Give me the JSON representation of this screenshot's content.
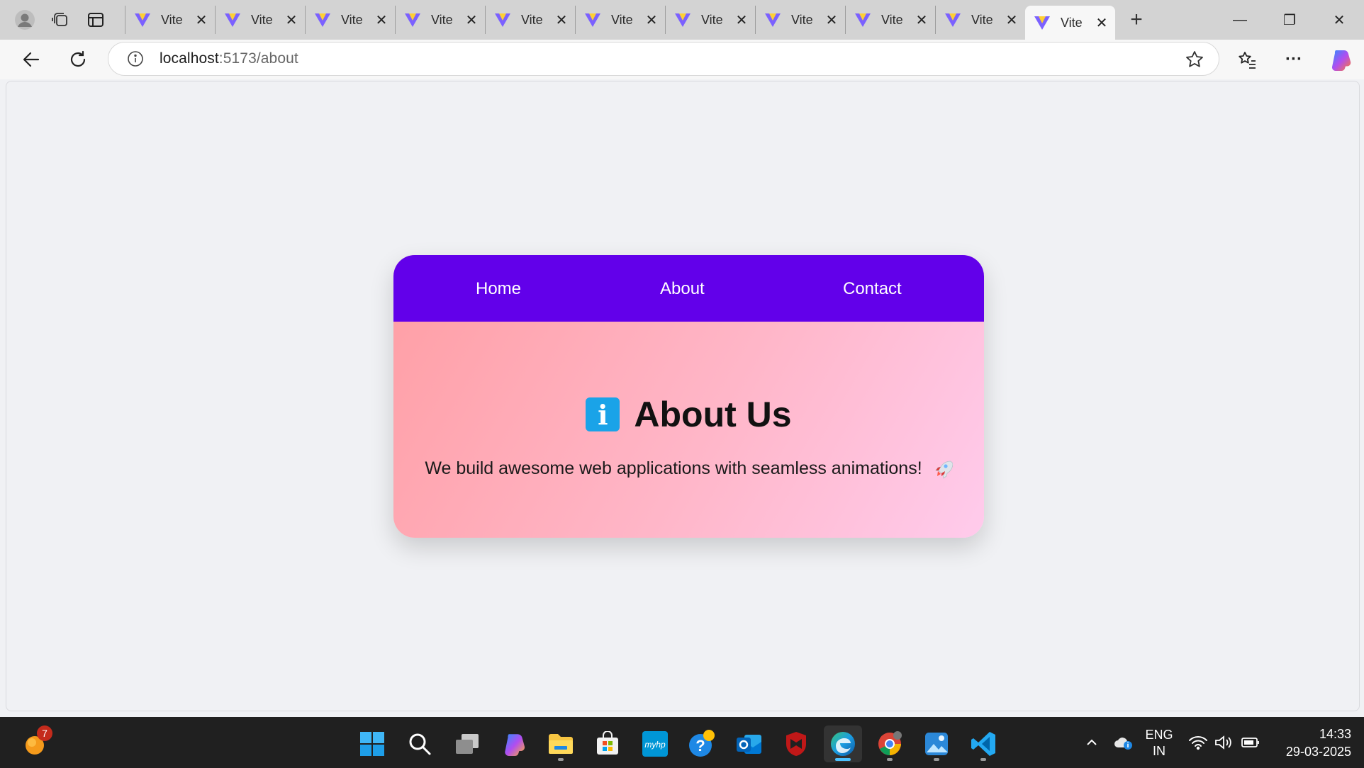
{
  "browser": {
    "tabs": [
      {
        "title": "Vite",
        "active": false
      },
      {
        "title": "Vite",
        "active": false
      },
      {
        "title": "Vite",
        "active": false
      },
      {
        "title": "Vite",
        "active": false
      },
      {
        "title": "Vite",
        "active": false
      },
      {
        "title": "Vite",
        "active": false
      },
      {
        "title": "Vite",
        "active": false
      },
      {
        "title": "Vite",
        "active": false
      },
      {
        "title": "Vite",
        "active": false
      },
      {
        "title": "Vite",
        "active": false
      },
      {
        "title": "Vite",
        "active": true
      }
    ],
    "tab_close_glyph": "✕",
    "new_tab_glyph": "+",
    "url_host": "localhost",
    "url_path": ":5173/about",
    "window_controls": {
      "minimize": "—",
      "restore": "❐",
      "close": "✕"
    },
    "more_glyph": "···"
  },
  "page": {
    "nav": {
      "home": "Home",
      "about": "About",
      "contact": "Contact"
    },
    "title": "About Us",
    "info_glyph": "i",
    "description": "We build awesome web applications with seamless animations!",
    "colors": {
      "nav_bg": "#6200ea",
      "card_gradient_start": "#ff9ea4",
      "card_gradient_end": "#ffcbec",
      "info_icon": "#1aa3e8"
    }
  },
  "taskbar": {
    "notification_badge": "7",
    "language": "ENG",
    "region": "IN",
    "time": "14:33",
    "date": "29-03-2025"
  }
}
